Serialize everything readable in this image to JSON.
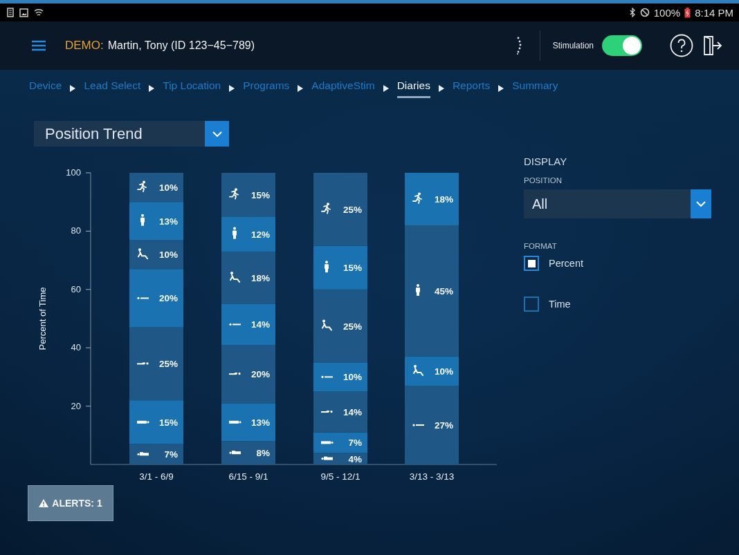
{
  "status_bar": {
    "battery": "100%",
    "time": "8:14 PM"
  },
  "header": {
    "demo_label": "DEMO:",
    "patient": "Martin, Tony (ID 123−45−789)",
    "stimulation": {
      "label": "Stimulation",
      "on": true
    }
  },
  "breadcrumbs": [
    {
      "label": "Device",
      "selected": false
    },
    {
      "label": "Lead Select",
      "selected": false
    },
    {
      "label": "Tip Location",
      "selected": false
    },
    {
      "label": "Programs",
      "selected": false
    },
    {
      "label": "AdaptiveStim",
      "selected": false
    },
    {
      "label": "Diaries",
      "selected": true
    },
    {
      "label": "Reports",
      "selected": false
    },
    {
      "label": "Summary",
      "selected": false
    }
  ],
  "report_select": {
    "value": "Position Trend"
  },
  "chart": {
    "chart_data": {
      "type": "bar",
      "stacked": true,
      "ylabel": "Percent of Time",
      "categories": [
        "3/1 - 6/9",
        "6/15 - 9/1",
        "9/5 - 12/1",
        "3/13 - 3/13"
      ],
      "ylim": [
        0,
        100
      ],
      "yticks": [
        20,
        40,
        60,
        80,
        100
      ],
      "series": [
        {
          "values": [
            7,
            8,
            4,
            null
          ],
          "value_labels": [
            "7%",
            "8%",
            "4%",
            null
          ],
          "colors": [
            "#1f5786",
            "#1f5786",
            "#1f5786",
            null
          ]
        },
        {
          "values": [
            15,
            13,
            7,
            null
          ],
          "value_labels": [
            "15%",
            "13%",
            "7%",
            null
          ],
          "colors": [
            "#1a73b0",
            "#1a73b0",
            "#1a73b0",
            null
          ]
        },
        {
          "values": [
            25,
            20,
            14,
            null
          ],
          "value_labels": [
            "25%",
            "20%",
            "14%",
            null
          ],
          "colors": [
            "#1f5786",
            "#1f5786",
            "#1f5786",
            null
          ]
        },
        {
          "values": [
            20,
            14,
            10,
            27
          ],
          "value_labels": [
            "20%",
            "14%",
            "10%",
            "27%"
          ],
          "colors": [
            "#1a73b0",
            "#1a73b0",
            "#1a73b0",
            "#1f5786"
          ]
        },
        {
          "values": [
            10,
            18,
            25,
            10
          ],
          "value_labels": [
            "10%",
            "18%",
            "25%",
            "10%"
          ],
          "colors": [
            "#1f5786",
            "#1f5786",
            "#1f5786",
            "#1a73b0"
          ]
        },
        {
          "values": [
            13,
            12,
            15,
            45
          ],
          "value_labels": [
            "13%",
            "12%",
            "15%",
            "45%"
          ],
          "colors": [
            "#1a73b0",
            "#1a73b0",
            "#1a73b0",
            "#1f5786"
          ]
        },
        {
          "values": [
            10,
            15,
            25,
            18
          ],
          "value_labels": [
            "10%",
            "15%",
            "25%",
            "18%"
          ],
          "colors": [
            "#1f5786",
            "#1f5786",
            "#1f5786",
            "#1a73b0"
          ]
        }
      ]
    },
    "series_icons": [
      {
        "kind": "lying_a"
      },
      {
        "kind": "lying_b"
      },
      {
        "kind": "lying_c"
      },
      {
        "kind": "lying_d"
      },
      {
        "kind": "reclining"
      },
      {
        "kind": "upright"
      },
      {
        "kind": "mobile"
      }
    ]
  },
  "display": {
    "heading": "DISPLAY",
    "position_label": "POSITION",
    "position_value": "All",
    "format_label": "FORMAT",
    "format_options": [
      {
        "label": "Percent",
        "selected": true
      },
      {
        "label": "Time",
        "selected": false
      }
    ]
  },
  "alerts_button": "ALERTS: 1"
}
